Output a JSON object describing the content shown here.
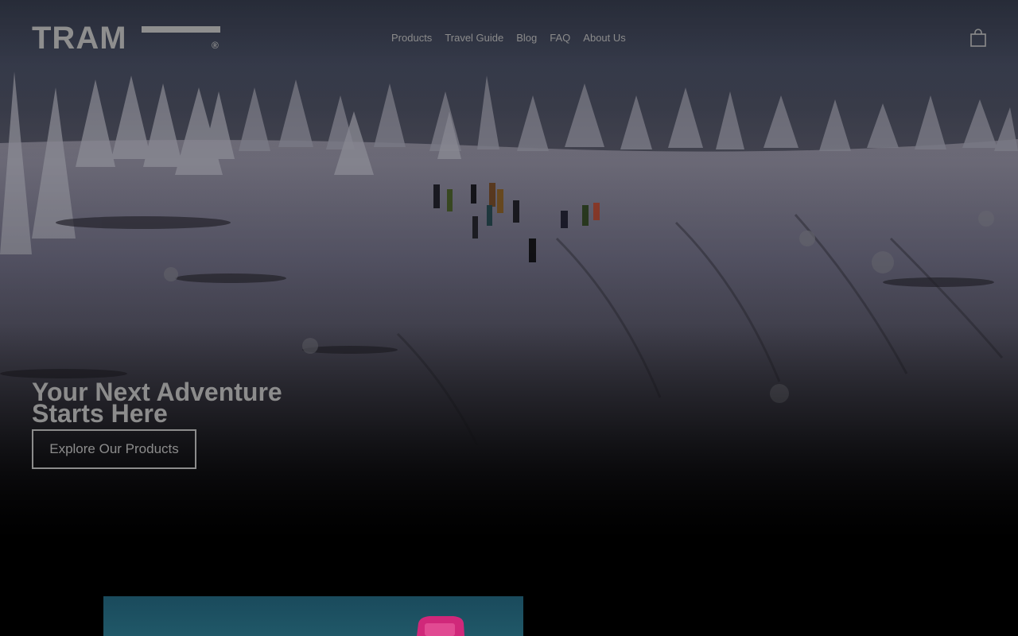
{
  "brand": {
    "name": "TRAM",
    "registered": "®"
  },
  "nav": {
    "items": [
      {
        "label": "Products"
      },
      {
        "label": "Travel Guide"
      },
      {
        "label": "Blog"
      },
      {
        "label": "FAQ"
      },
      {
        "label": "About Us"
      }
    ]
  },
  "cart": {
    "icon": "shopping-bag-icon"
  },
  "hero": {
    "headline_line1": "Your Next Adventure",
    "headline_line2": "Starts Here",
    "cta_label": "Explore Our Products",
    "image": "snowy-forest-hikers"
  },
  "featured": {
    "image": "pink-bottle-product"
  },
  "colors": {
    "text": "#8c8c8c",
    "background": "#000000"
  }
}
